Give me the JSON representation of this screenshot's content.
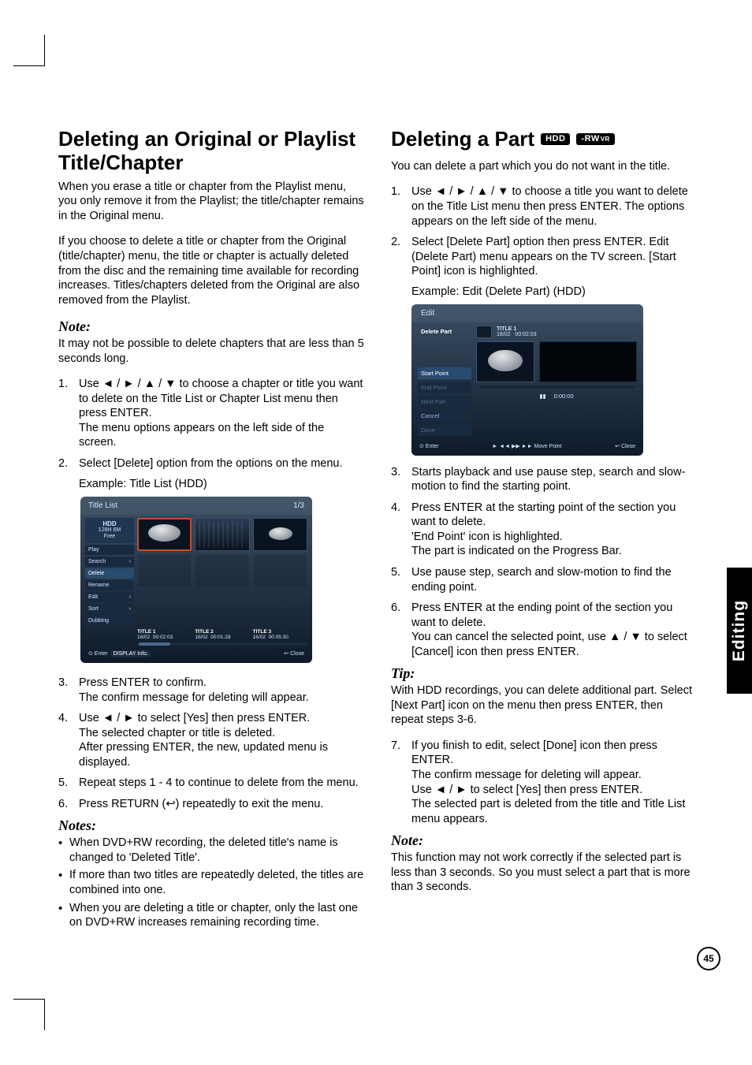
{
  "sideTab": "Editing",
  "pageNumber": "45",
  "left": {
    "heading": "Deleting an Original or Playlist Title/Chapter",
    "intro1": "When you erase a title or chapter from the Playlist menu, you only remove it from the Playlist; the title/chapter remains in the Original menu.",
    "intro2": "If you choose to delete a title or chapter from the Original (title/chapter) menu, the title or chapter is actually deleted from the disc and the remaining time available for recording increases. Titles/chapters deleted from the Original are also removed from the Playlist.",
    "noteHeading": "Note:",
    "noteText": "It may not be possible to delete chapters that are less than 5 seconds long.",
    "steps12": {
      "s1": "Use ◄ / ► / ▲ / ▼ to choose a chapter or title you want to delete on the Title List or Chapter List menu then press ENTER.\nThe menu options appears on the left side of the screen.",
      "s2": "Select [Delete] option from the options on the menu."
    },
    "exampleCaption": "Example: Title List (HDD)",
    "steps36": {
      "s3": "Press ENTER to confirm.\nThe confirm message for deleting will appear.",
      "s4": "Use ◄ / ► to select [Yes] then press ENTER.\nThe selected chapter or title is deleted.\nAfter pressing ENTER, the new, updated menu is displayed.",
      "s5": "Repeat steps 1 - 4 to continue to delete from the menu.",
      "s6": "Press RETURN (↩) repeatedly to exit the menu."
    },
    "notesHeading": "Notes:",
    "notes": {
      "n1": "When DVD+RW recording, the deleted title's name is changed to 'Deleted Title'.",
      "n2": "If more than two titles are repeatedly deleted, the titles are combined into one.",
      "n3": "When you are deleting a title or chapter, only the last one on DVD+RW increases remaining recording time."
    },
    "titleListUI": {
      "header": "Title List",
      "page": "1/3",
      "topPill": {
        "line1": "HDD",
        "line2": "128H 6M",
        "line3": "Free"
      },
      "menu": [
        "Play",
        "Search",
        "Delete",
        "Rename",
        "Edit",
        "Sort",
        "Dubbing"
      ],
      "titles": [
        {
          "name": "TITLE 1",
          "date": "16/02",
          "dur": "00:02:03"
        },
        {
          "name": "TITLE 2",
          "date": "16/02",
          "dur": "00:01:28"
        },
        {
          "name": "TITLE 3",
          "date": "16/02",
          "dur": "00:05:30"
        }
      ],
      "footerLeft": "⊙ Enter",
      "footerMid": "DISPLAY Info.",
      "footerRight": "↩ Close"
    }
  },
  "right": {
    "heading": "Deleting a Part",
    "badges": {
      "b1": "HDD",
      "b2_main": "-RW",
      "b2_sub": "VR"
    },
    "intro": "You can delete a part which you do not want in the title.",
    "steps12": {
      "s1": "Use ◄ / ► / ▲ / ▼ to choose a title you want to delete on the Title List menu then press ENTER. The options appears on the left side of the menu.",
      "s2": "Select [Delete Part] option then press ENTER. Edit (Delete Part) menu appears on the TV screen. [Start Point] icon is highlighted."
    },
    "exampleCaption": "Example: Edit (Delete Part) (HDD)",
    "steps36": {
      "s3": "Starts playback and use pause step, search and slow-motion to find the starting point.",
      "s4": "Press ENTER at the starting point of the section you want to delete.\n'End Point' icon is highlighted.\nThe part is indicated on the Progress Bar.",
      "s5": "Use pause step, search and slow-motion to find the ending point.",
      "s6": "Press ENTER at the ending point of the section you want to delete.\nYou can cancel the selected point, use ▲ / ▼ to select [Cancel] icon then press ENTER."
    },
    "tipHeading": "Tip:",
    "tipText": "With HDD recordings, you can delete additional part. Select [Next Part] icon on the menu then press ENTER, then repeat steps 3-6.",
    "step7": "If you finish to edit, select [Done] icon then press ENTER.\nThe confirm message for deleting will appear.\nUse ◄ / ► to select [Yes] then press ENTER.\nThe selected part is deleted from the title and Title List menu appears.",
    "noteHeading": "Note:",
    "noteText": "This function may not work correctly if the selected part is less than 3 seconds. So you must select a part that is more than 3 seconds.",
    "editUI": {
      "header": "Edit",
      "sideTitle": "Delete Part",
      "thumbMeta": {
        "name": "TITLE 1",
        "date": "16/02",
        "dur": "00:02:03"
      },
      "menu": [
        "Start Point",
        "End Point",
        "Next Part",
        "Cancel",
        "Done"
      ],
      "pauseIcon": "▮▮",
      "time": "0:00:00",
      "footerLeft": "⊙ Enter",
      "footerMid": "► ◄◄ ▶▶ ►► Move Point",
      "footerRight": "↩ Close"
    }
  }
}
